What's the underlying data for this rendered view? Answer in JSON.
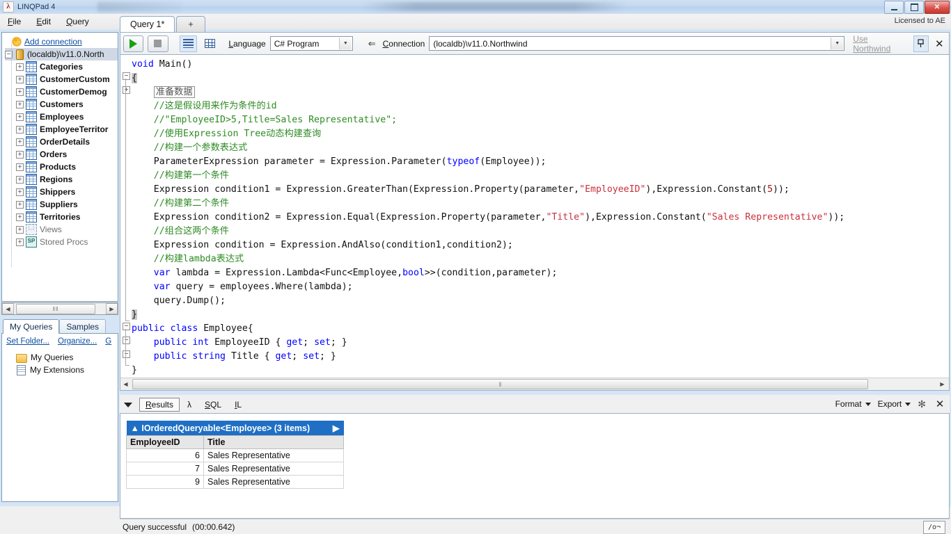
{
  "window": {
    "title": "LINQPad 4",
    "app_icon": "linqpad-lambda-icon",
    "minimize_label": "–",
    "maximize_label": "❐",
    "close_label": "✕"
  },
  "menu": {
    "items": [
      {
        "label": "File",
        "accel": "F"
      },
      {
        "label": "Edit",
        "accel": "E"
      },
      {
        "label": "Query",
        "accel": "Q"
      }
    ],
    "licensed_to": "Licensed to AE"
  },
  "sidebar": {
    "add_connection": "Add connection",
    "connection": "(localdb)\\v11.0.North",
    "tables": [
      "Categories",
      "CustomerCustom",
      "CustomerDemog",
      "Customers",
      "Employees",
      "EmployeeTerritor",
      "OrderDetails",
      "Orders",
      "Products",
      "Regions",
      "Shippers",
      "Suppliers",
      "Territories"
    ],
    "views_label": "Views",
    "stored_procs_label": "Stored Procs",
    "stored_procs_icon_text": "SP",
    "hscroll_thumb_glyph": "‖‖",
    "hscroll_left": "◀",
    "hscroll_right": "▶",
    "tabs": [
      {
        "label": "My Queries",
        "active": true
      },
      {
        "label": "Samples",
        "active": false
      }
    ],
    "links": [
      {
        "label": "Set Folder..."
      },
      {
        "label": "Organize..."
      },
      {
        "label": "G"
      }
    ],
    "query_tree": [
      {
        "label": "My Queries",
        "icon": "folder-icon"
      },
      {
        "label": "My Extensions",
        "icon": "document-icon"
      }
    ]
  },
  "doc_tabs": [
    {
      "label": "Query 1*",
      "active": true
    },
    {
      "label": "+",
      "active": false
    }
  ],
  "toolbar": {
    "run_icon": "play-icon",
    "stop_icon": "stop-icon",
    "rows_view_icon": "rows-view-icon",
    "grid_view_icon": "grid-view-icon",
    "language_label": "Language",
    "language_value": "C# Program",
    "arrow_icon": "left-arrow-icon",
    "connection_label": "Connection",
    "connection_value": "(localdb)\\v11.0.Northwind",
    "use_link": "Use Northwind",
    "pin_icon": "pin-icon",
    "close_icon": "close-icon"
  },
  "editor": {
    "collapsed_region_text": "准备数据",
    "lines": [
      {
        "id": "l1",
        "indent": 0,
        "parts": [
          {
            "t": "void",
            "c": "k"
          },
          {
            "t": " Main()",
            "c": ""
          }
        ]
      },
      {
        "id": "l2",
        "indent": 0,
        "parts": [
          {
            "t": "{",
            "c": "cursorbg"
          }
        ]
      },
      {
        "id": "l3",
        "indent": 1,
        "parts": [
          {
            "t": "准备数据",
            "c": "collapsed"
          }
        ]
      },
      {
        "id": "l4",
        "indent": 1,
        "parts": [
          {
            "t": "//这是假设用来作为条件的id",
            "c": "cm"
          }
        ]
      },
      {
        "id": "l5",
        "indent": 1,
        "parts": [
          {
            "t": "//\"EmployeeID>5,Title=Sales Representative\";",
            "c": "cm"
          }
        ]
      },
      {
        "id": "l6",
        "indent": 1,
        "parts": [
          {
            "t": "//使用Expression Tree动态构建查询",
            "c": "cm"
          }
        ]
      },
      {
        "id": "l7",
        "indent": 1,
        "parts": [
          {
            "t": "//构建一个参数表达式",
            "c": "cm"
          }
        ]
      },
      {
        "id": "l8",
        "indent": 1,
        "parts": [
          {
            "t": "ParameterExpression parameter = Expression.Parameter(",
            "c": ""
          },
          {
            "t": "typeof",
            "c": "k"
          },
          {
            "t": "(Employee));",
            "c": ""
          }
        ]
      },
      {
        "id": "l9",
        "indent": 1,
        "parts": [
          {
            "t": "//构建第一个条件",
            "c": "cm"
          }
        ]
      },
      {
        "id": "l10",
        "indent": 1,
        "parts": [
          {
            "t": "Expression condition1 = Expression.GreaterThan(Expression.Property(parameter,",
            "c": ""
          },
          {
            "t": "\"EmployeeID\"",
            "c": "str"
          },
          {
            "t": "),Expression.Constant(",
            "c": ""
          },
          {
            "t": "5",
            "c": "num"
          },
          {
            "t": "));",
            "c": ""
          }
        ]
      },
      {
        "id": "l11",
        "indent": 1,
        "parts": [
          {
            "t": "//构建第二个条件",
            "c": "cm"
          }
        ]
      },
      {
        "id": "l12",
        "indent": 1,
        "parts": [
          {
            "t": "Expression condition2 = Expression.Equal(Expression.Property(parameter,",
            "c": ""
          },
          {
            "t": "\"Title\"",
            "c": "str"
          },
          {
            "t": "),Expression.Constant(",
            "c": ""
          },
          {
            "t": "\"Sales Representative\"",
            "c": "str"
          },
          {
            "t": "));",
            "c": ""
          }
        ]
      },
      {
        "id": "l13",
        "indent": 1,
        "parts": [
          {
            "t": "//组合这两个条件",
            "c": "cm"
          }
        ]
      },
      {
        "id": "l14",
        "indent": 1,
        "parts": [
          {
            "t": "Expression condition = Expression.AndAlso(condition1,condition2);",
            "c": ""
          }
        ]
      },
      {
        "id": "l15",
        "indent": 1,
        "parts": [
          {
            "t": "//构建lambda表达式",
            "c": "cm"
          }
        ]
      },
      {
        "id": "l16",
        "indent": 1,
        "parts": [
          {
            "t": "var",
            "c": "k"
          },
          {
            "t": " lambda = Expression.Lambda<Func<Employee,",
            "c": ""
          },
          {
            "t": "bool",
            "c": "k"
          },
          {
            "t": ">>(condition,parameter);",
            "c": ""
          }
        ]
      },
      {
        "id": "l17",
        "indent": 1,
        "parts": [
          {
            "t": "var",
            "c": "k"
          },
          {
            "t": " query = employees.Where(lambda);",
            "c": ""
          }
        ]
      },
      {
        "id": "l18",
        "indent": 1,
        "parts": [
          {
            "t": "query.Dump();",
            "c": ""
          }
        ]
      },
      {
        "id": "l19",
        "indent": 0,
        "parts": [
          {
            "t": "}",
            "c": "cursorbg"
          }
        ]
      },
      {
        "id": "l20",
        "indent": 0,
        "parts": [
          {
            "t": "public",
            "c": "k"
          },
          {
            "t": " ",
            "c": ""
          },
          {
            "t": "class",
            "c": "k"
          },
          {
            "t": " Employee{",
            "c": ""
          }
        ]
      },
      {
        "id": "l21",
        "indent": 1,
        "parts": [
          {
            "t": "public",
            "c": "k"
          },
          {
            "t": " ",
            "c": ""
          },
          {
            "t": "int",
            "c": "k"
          },
          {
            "t": " EmployeeID { ",
            "c": ""
          },
          {
            "t": "get",
            "c": "k"
          },
          {
            "t": "; ",
            "c": ""
          },
          {
            "t": "set",
            "c": "k"
          },
          {
            "t": "; }",
            "c": ""
          }
        ]
      },
      {
        "id": "l22",
        "indent": 1,
        "parts": [
          {
            "t": "public",
            "c": "k"
          },
          {
            "t": " ",
            "c": ""
          },
          {
            "t": "string",
            "c": "k"
          },
          {
            "t": " Title { ",
            "c": ""
          },
          {
            "t": "get",
            "c": "k"
          },
          {
            "t": "; ",
            "c": ""
          },
          {
            "t": "set",
            "c": "k"
          },
          {
            "t": "; }",
            "c": ""
          }
        ]
      },
      {
        "id": "l23",
        "indent": 0,
        "parts": [
          {
            "t": "}",
            "c": ""
          }
        ]
      }
    ],
    "scroll_left_arrow": "◀",
    "scroll_right_arrow": "▶",
    "scroll_thumb_glyph": "‖"
  },
  "results": {
    "collapse_icon": "caret-down-icon",
    "tabs": [
      {
        "label": "Results",
        "active": true
      },
      {
        "label": "λ",
        "active": false
      },
      {
        "label": "SQL",
        "active": false
      },
      {
        "label": "IL",
        "active": false
      }
    ],
    "format_label": "Format",
    "export_label": "Export",
    "snowflake_icon": "snowflake-icon",
    "close_icon": "close-icon",
    "grid": {
      "caption": "IOrderedQueryable<Employee> (3 items)",
      "collapse_glyph": "▲",
      "expand_glyph": "▶",
      "columns": [
        "EmployeeID",
        "Title"
      ],
      "rows": [
        [
          "6",
          "Sales Representative"
        ],
        [
          "7",
          "Sales Representative"
        ],
        [
          "9",
          "Sales Representative"
        ]
      ]
    }
  },
  "statusbar": {
    "message": "Query successful",
    "duration": "(00:00.642)",
    "corner_glyph": "/o¬"
  }
}
